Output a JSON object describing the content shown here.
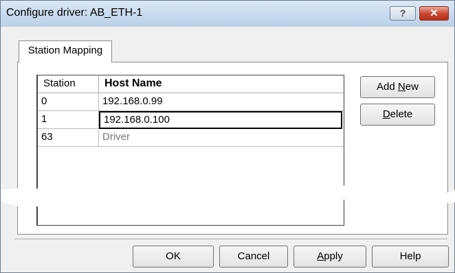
{
  "window": {
    "title": "Configure driver: AB_ETH-1"
  },
  "titlebar": {
    "help_glyph": "?",
    "close_glyph": "✕"
  },
  "tabs": [
    {
      "label": "Station Mapping"
    }
  ],
  "grid": {
    "columns": [
      "Station",
      "Host Name"
    ],
    "rows": [
      {
        "station": "0",
        "host": "192.168.0.99"
      },
      {
        "station": "1",
        "host": "192.168.0.100"
      },
      {
        "station": "63",
        "host": "Driver"
      }
    ]
  },
  "side_buttons": {
    "add_new": {
      "pre": "Add ",
      "mnemonic": "N",
      "post": "ew"
    },
    "delete": {
      "pre": "",
      "mnemonic": "D",
      "post": "elete"
    }
  },
  "footer_buttons": {
    "ok": "OK",
    "cancel": "Cancel",
    "apply": {
      "pre": "",
      "mnemonic": "A",
      "post": "pply"
    },
    "help": "Help"
  },
  "colors": {
    "close_button": "#c8432b",
    "titlebar": "#c8daee"
  }
}
